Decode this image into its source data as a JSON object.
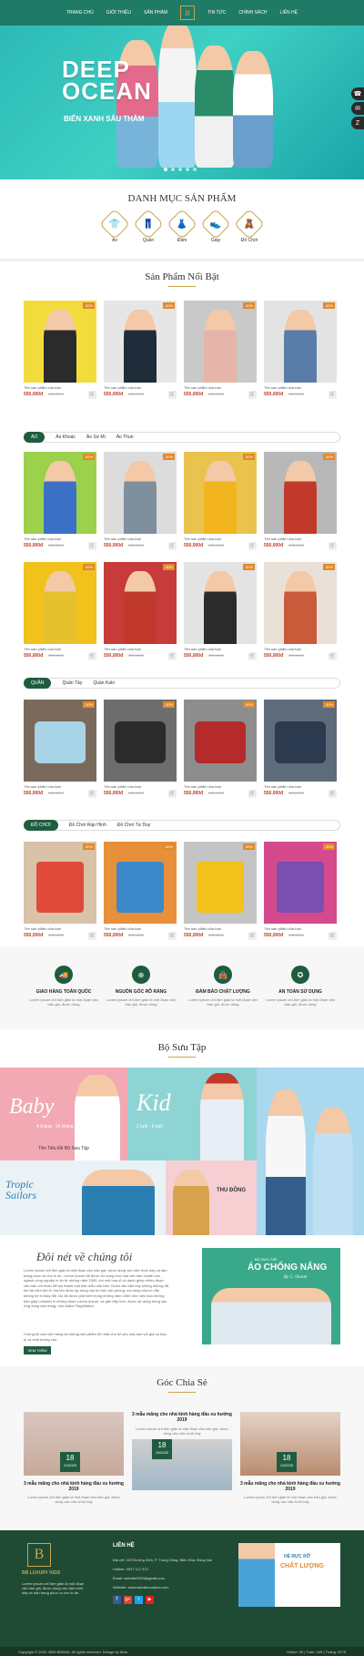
{
  "nav": {
    "items": [
      "TRANG CHỦ",
      "GIỚI THIỆU",
      "SẢN PHẨM",
      "TIN TỨC",
      "CHÍNH SÁCH",
      "LIÊN HỆ"
    ],
    "logo": "B"
  },
  "hero": {
    "title_1": "DEEP",
    "title_2": "OCEAN",
    "subtitle": "BIỂN XANH SÂU THẲM"
  },
  "categories": {
    "title": "DANH MỤC SẢN PHẨM",
    "items": [
      {
        "label": "Áo",
        "icon": "shirt-icon",
        "glyph": "👕"
      },
      {
        "label": "Quần",
        "icon": "pants-icon",
        "glyph": "👖"
      },
      {
        "label": "Đầm",
        "icon": "dress-icon",
        "glyph": "👗"
      },
      {
        "label": "Giày",
        "icon": "shoe-icon",
        "glyph": "👟"
      },
      {
        "label": "Đồ Chơi",
        "icon": "toy-icon",
        "glyph": "🧸"
      }
    ]
  },
  "featured": {
    "title": "Sản Phẩm Nổi Bật"
  },
  "product": {
    "name": "Tên sản phẩm của bạn",
    "price": "550,000đ",
    "old_price": "550,000đ",
    "badge": "-30%"
  },
  "tabs_ao": {
    "active": "ÁO",
    "items": [
      "Áo Khoác",
      "Áo Sơ Mi",
      "Áo Thun"
    ]
  },
  "tabs_quan": {
    "active": "QUẦN",
    "items": [
      "Quần Tây",
      "Quần Kaki"
    ]
  },
  "tabs_dochoi": {
    "active": "ĐỒ CHƠI",
    "items": [
      "Đồ Chơi Ráp Hình",
      "Đồ Chơi Tư Duy"
    ]
  },
  "services": [
    {
      "title": "GIAO HÀNG TOÀN QUỐC",
      "desc": "Lorem ipsum chỉ đơn giản là một đoạn văn bản giả, được dùng"
    },
    {
      "title": "NGUỒN GỐC RÕ RÀNG",
      "desc": "Lorem ipsum chỉ đơn giản là một đoạn văn bản giả, được dùng"
    },
    {
      "title": "ĐẢM BẢO CHẤT LƯỢNG",
      "desc": "Lorem ipsum chỉ đơn giản là một đoạn văn bản giả, được dùng"
    },
    {
      "title": "AN TOÀN SỬ DỤNG",
      "desc": "Lorem ipsum chỉ đơn giản là một đoạn văn bản giả, được dùng"
    }
  ],
  "collection": {
    "title": "Bộ Sưu Tập",
    "baby": "Baby",
    "baby_sub": "4 tháng - 24 tháng",
    "baby_caption": "Tên Tiêu Đề Bộ Sưu Tập",
    "kid": "Kid",
    "kid_sub": "2 tuổi - 9 tuổi",
    "tropic": "Tropic Sailors",
    "winter": "THU ĐÔNG"
  },
  "about": {
    "title": "Đôi nét về chúng tôi",
    "text": "Lorem Ipsum chỉ đơn giản là một đoạn văn bản giả, được dùng vào việc trình bày và dàn trang phục vụ cho in ấn. Lorem Ipsum đã được sử dụng như một văn bản chuẩn cho ngành công nghiệp in ấn từ những năm 1500, khi một họa sĩ vô danh ghép nhiều đoạn văn bản với nhau để tạo thành một bản mẫu văn bản. Đoạn văn bản này không những đã tồn tại năm thế kỉ, mà khi được áp dụng vào tin học văn phòng, nội dung của nó vẫn không hề bị thay đổi. Nó đã được phổ biến trong những năm 1960 nhờ việc bán những bản giấy Letraset in những đoạn Lorem Ipsum, và gần đây hơn, được sử dụng trong các ứng dụng dàn trang, như Aldus PageMaker.",
    "text2": "Chúng tôi cam kết mang lại những sản phẩm tốt nhất cho bé yêu của bạn với giá cả hợp lý và chất lượng cao.",
    "btn": "XEM THÊM",
    "banner_small": "BỘ SƯU TẬP",
    "banner_title": "ÁO CHỐNG NẮNG",
    "banner_sub": "By C. Ocean"
  },
  "blog": {
    "title": "Góc Chia Sẻ",
    "posts": [
      {
        "title": "3 mẫu măng cho nhà kính hàng đầu xu hướng 2019",
        "day": "18",
        "month": "11/2020",
        "desc": "Lorem ipsum chỉ đơn giản là một đoạn văn bản giả, được dùng vào việc trình bày"
      },
      {
        "title": "3 mẫu măng cho nhà kính hàng đầu xu hướng 2019",
        "day": "18",
        "month": "11/2020",
        "desc": "Lorem ipsum chỉ đơn giản là một đoạn văn bản giả, được dùng vào việc trình bày"
      },
      {
        "title": "3 mẫu măng cho nhà kính hàng đầu xu hướng 2019",
        "day": "18",
        "month": "11/2020",
        "desc": "Lorem ipsum chỉ đơn giản là một đoạn văn bản giả, được dùng vào việc trình bày"
      }
    ]
  },
  "footer": {
    "brand": "BB LUXURY KIDS",
    "contact_title": "LIÊN HỆ",
    "address": "Địa chỉ: 222 Đường 30/4, P. Trung Dũng, Biên Hòa, Đồng Nai",
    "phone": "Hotline: 0917 117 372",
    "email": "Email: website2020@gmail.com",
    "web": "Website: www.websitecuaban.com",
    "desc": "Lorem ipsum chỉ đơn giản là một đoạn văn bản giả, được dùng vào việc trình bày và dàn trang phục vụ cho in ấn.",
    "promo_small": "HÈ RỰC RỠ",
    "promo_big": "CHẤT LƯỢNG",
    "copyright": "Copyright © 2020. BBS BRAND. All rights reserved. Design by Nina",
    "stats": "Online: 99  |  Tuần: 345  |  Tháng: 3275"
  }
}
